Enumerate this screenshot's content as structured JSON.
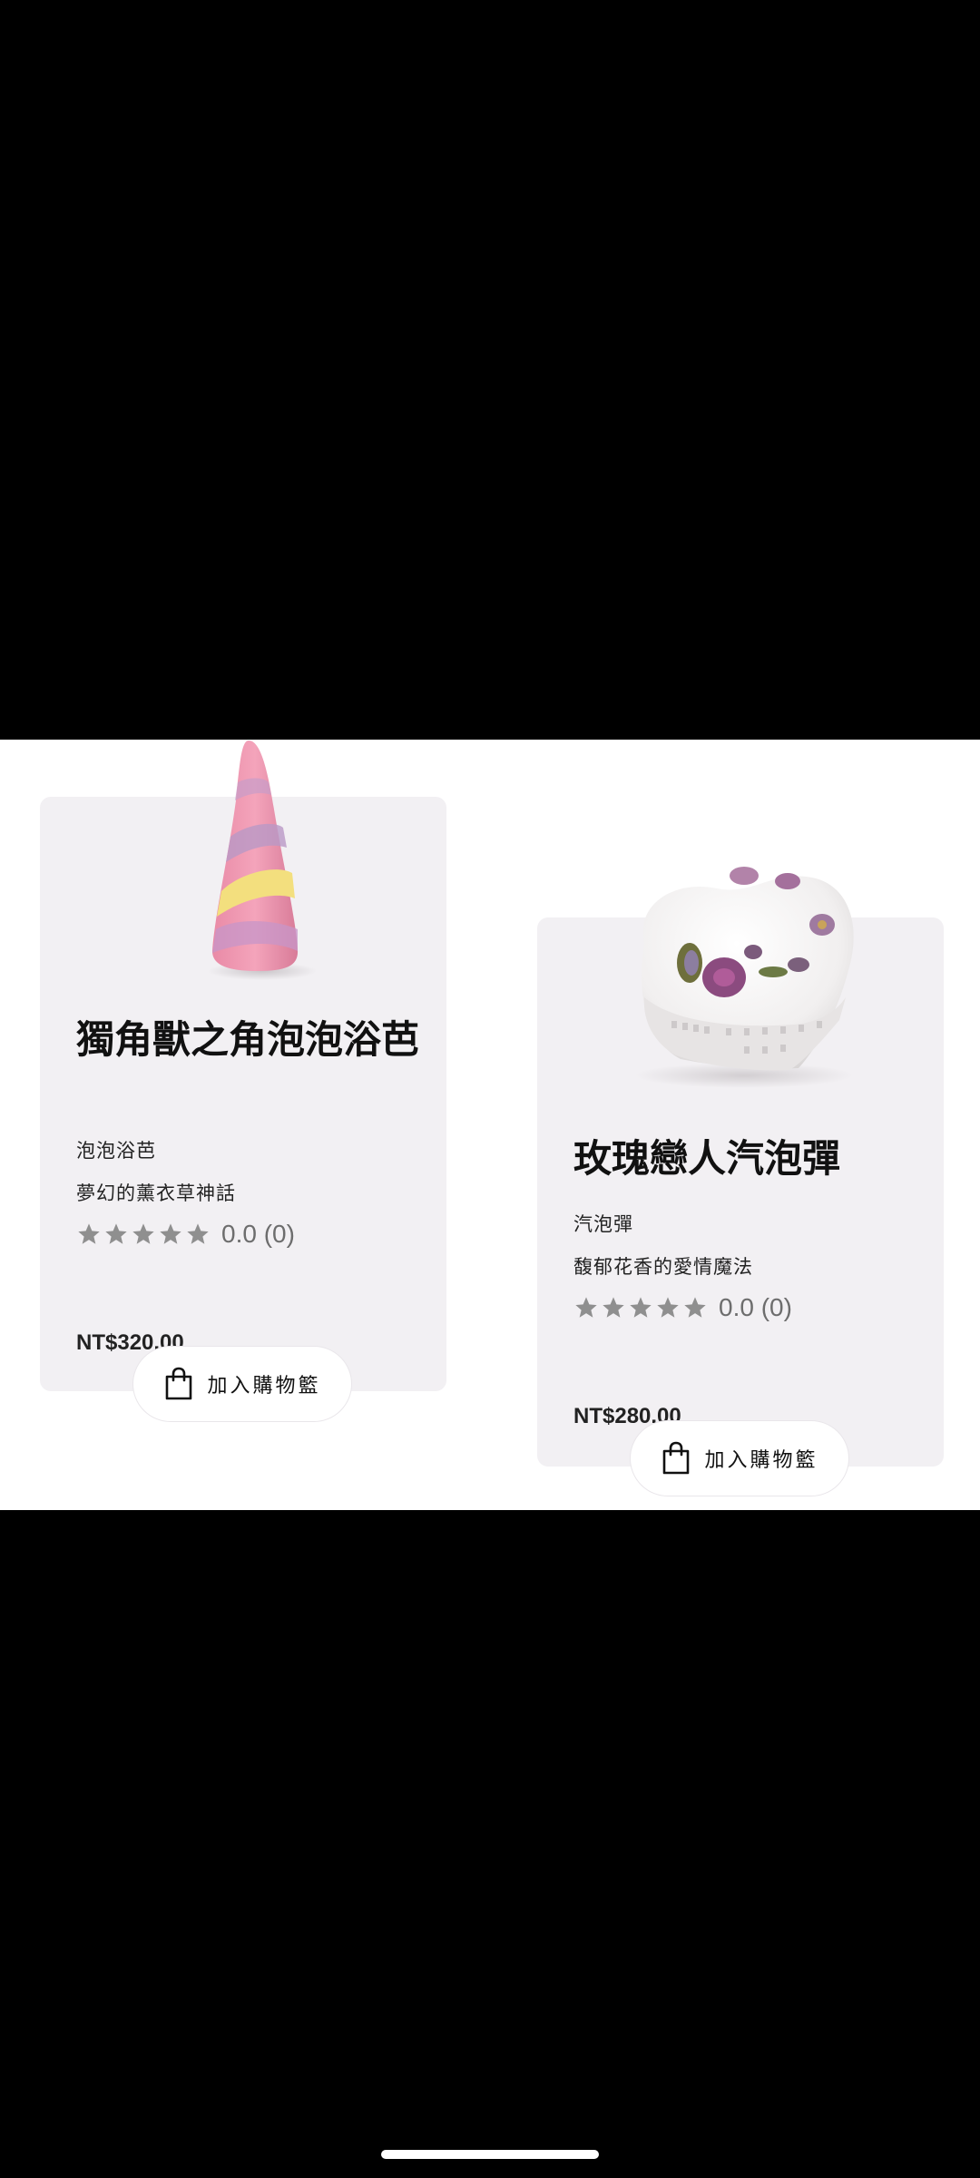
{
  "products": [
    {
      "name": "獨角獸之角泡泡浴芭",
      "category": "泡泡浴芭",
      "tagline": "夢幻的薰衣草神話",
      "rating": "0.0 (0)",
      "price": "NT$320.00",
      "cart_label": "加入購物籃",
      "image_icon": "unicorn-horn-bubble-bar-image",
      "stars_filled": 0,
      "stars_total": 5
    },
    {
      "name": "玫瑰戀人汽泡彈",
      "category": "汽泡彈",
      "tagline": "馥郁花香的愛情魔法",
      "rating": "0.0 (0)",
      "price": "NT$280.00",
      "cart_label": "加入購物籃",
      "image_icon": "rose-heart-bath-bomb-image",
      "stars_filled": 0,
      "stars_total": 5
    }
  ],
  "colors": {
    "card_background": "#f2f0f3",
    "star_empty": "#8f8f8f",
    "page_background": "#ffffff",
    "frame_background": "#000000"
  }
}
